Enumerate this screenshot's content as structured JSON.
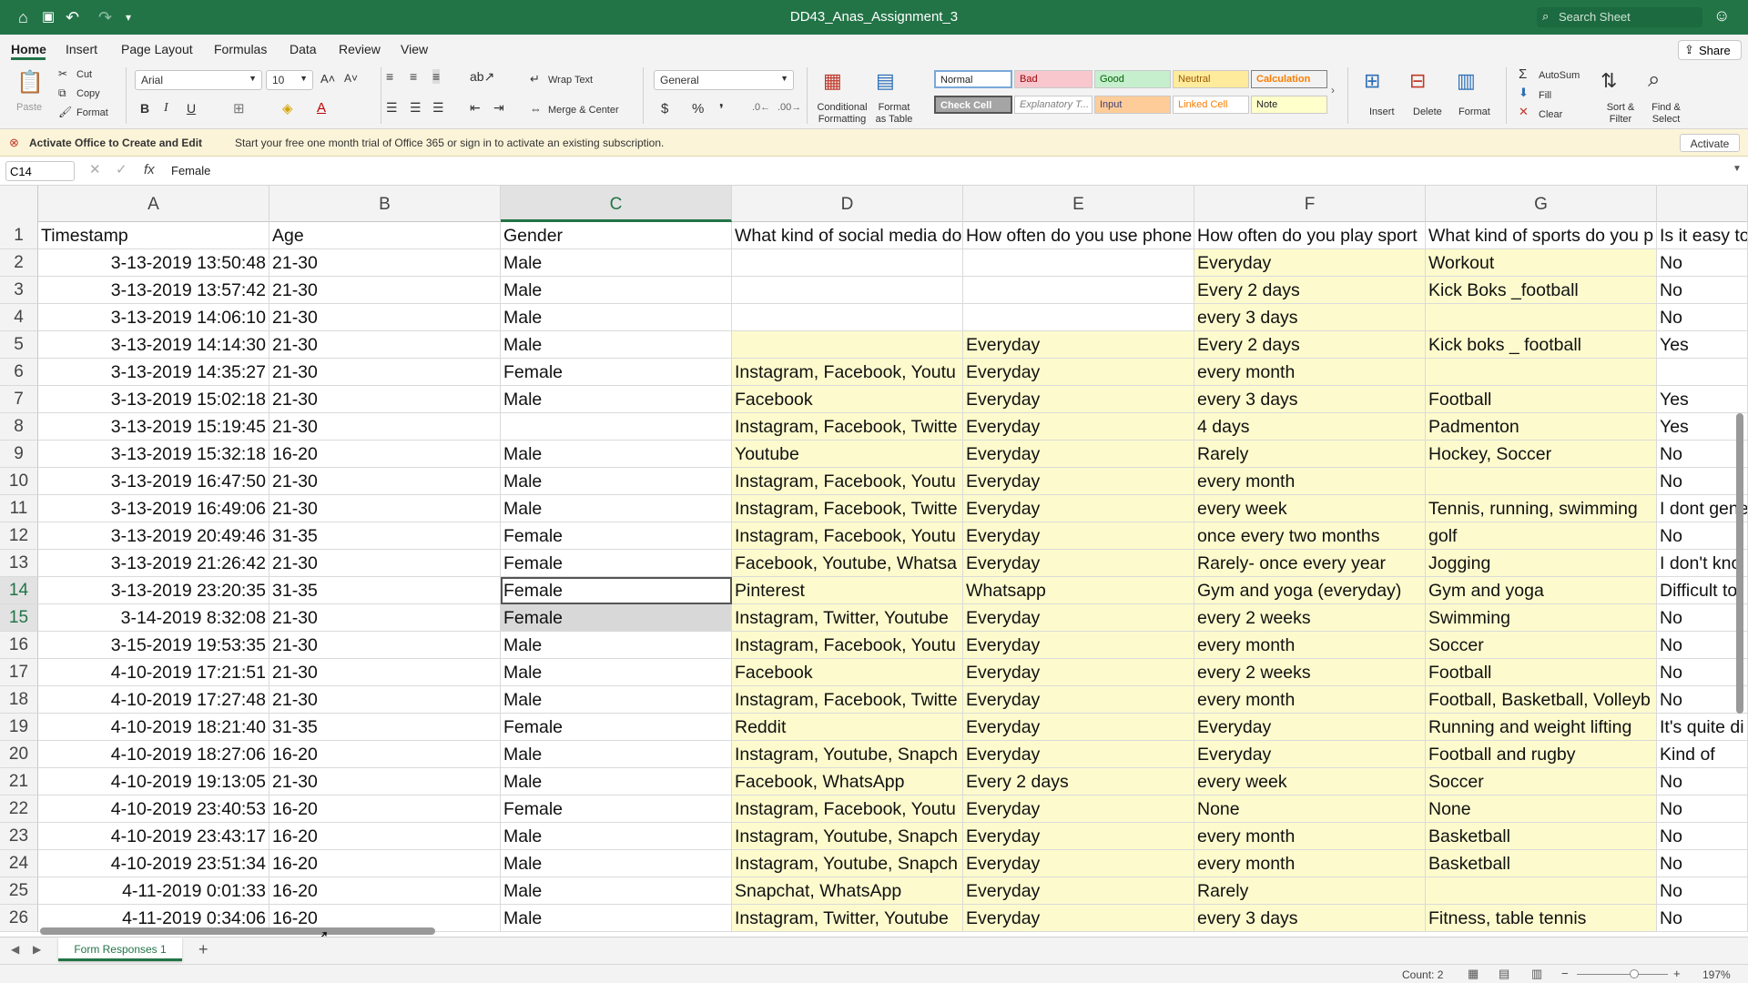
{
  "app": {
    "title": "DD43_Anas_Assignment_3",
    "search_placeholder": "Search Sheet",
    "quick_access": [
      "home-icon",
      "save-icon",
      "undo-icon",
      "redo-icon",
      "customize-icon"
    ]
  },
  "tabs": [
    "Home",
    "Insert",
    "Page Layout",
    "Formulas",
    "Data",
    "Review",
    "View"
  ],
  "share_label": "Share",
  "ribbon": {
    "paste": "Paste",
    "cut": "Cut",
    "copy": "Copy",
    "format": "Format",
    "font_name": "Arial",
    "font_size": "10",
    "wrap_text": "Wrap Text",
    "merge_center": "Merge & Center",
    "number_format": "General",
    "conditional_formatting": [
      "Conditional",
      "Formatting"
    ],
    "format_as_table": [
      "Format",
      "as Table"
    ],
    "styles": [
      {
        "label": "Normal",
        "bg": "#ffffff",
        "fg": "#222222"
      },
      {
        "label": "Bad",
        "bg": "#f8c7ce",
        "fg": "#9c0006"
      },
      {
        "label": "Good",
        "bg": "#c6efce",
        "fg": "#006100"
      },
      {
        "label": "Neutral",
        "bg": "#feeb9c",
        "fg": "#9c5700"
      },
      {
        "label": "Calculation",
        "bg": "#f2f2f2",
        "fg": "#fa7d00"
      },
      {
        "label": "Check Cell",
        "bg": "#a5a5a5",
        "fg": "#ffffff"
      },
      {
        "label": "Explanatory T...",
        "bg": "#ffffff",
        "fg": "#7f7f7f"
      },
      {
        "label": "Input",
        "bg": "#fecc99",
        "fg": "#3f3f76"
      },
      {
        "label": "Linked Cell",
        "bg": "#ffffff",
        "fg": "#fa7d00"
      },
      {
        "label": "Note",
        "bg": "#ffffcc",
        "fg": "#222222"
      }
    ],
    "insert": "Insert",
    "delete": "Delete",
    "format_cells": "Format",
    "autosum": "AutoSum",
    "fill": "Fill",
    "clear": "Clear",
    "sort_filter": [
      "Sort &",
      "Filter"
    ],
    "find_select": [
      "Find &",
      "Select"
    ]
  },
  "message": {
    "title": "Activate Office to Create and Edit",
    "text": "Start your free one month trial of Office 365 or sign in to activate an existing subscription.",
    "button": "Activate"
  },
  "formula_bar": {
    "cell_ref": "C14",
    "fx": "fx",
    "value": "Female"
  },
  "columns": [
    "A",
    "B",
    "C",
    "D",
    "E",
    "F",
    "G",
    ""
  ],
  "rows": [
    {
      "n": "1",
      "cells": [
        "Timestamp",
        "Age",
        "Gender",
        "What kind of social media do",
        "How often do you use phone",
        "How often do you play sport",
        "What kind of sports do you p",
        "Is it easy to"
      ]
    },
    {
      "n": "2",
      "cells": [
        "3-13-2019 13:50:48",
        "21-30",
        "Male",
        "",
        "",
        "Everyday",
        "Workout",
        "No"
      ]
    },
    {
      "n": "3",
      "cells": [
        "3-13-2019 13:57:42",
        "21-30",
        "Male",
        "",
        "",
        "Every 2 days",
        "Kick Boks _football",
        "No"
      ]
    },
    {
      "n": "4",
      "cells": [
        "3-13-2019 14:06:10",
        "21-30",
        "Male",
        "",
        "",
        "every 3 days",
        "",
        "No"
      ]
    },
    {
      "n": "5",
      "cells": [
        "3-13-2019 14:14:30",
        "21-30",
        "Male",
        "",
        "Everyday",
        "Every 2 days",
        "Kick boks _ football",
        "Yes"
      ]
    },
    {
      "n": "6",
      "cells": [
        "3-13-2019 14:35:27",
        "21-30",
        "Female",
        "Instagram, Facebook, Youtu",
        "Everyday",
        "every month",
        "",
        ""
      ]
    },
    {
      "n": "7",
      "cells": [
        "3-13-2019 15:02:18",
        "21-30",
        "Male",
        "Facebook",
        "Everyday",
        "every 3 days",
        "Football",
        "Yes"
      ]
    },
    {
      "n": "8",
      "cells": [
        "3-13-2019 15:19:45",
        "21-30",
        "",
        "Instagram, Facebook, Twitte",
        "Everyday",
        "4 days",
        "Padmenton",
        "Yes"
      ]
    },
    {
      "n": "9",
      "cells": [
        "3-13-2019 15:32:18",
        "16-20",
        "Male",
        "Youtube",
        "Everyday",
        "Rarely",
        "Hockey, Soccer",
        "No"
      ]
    },
    {
      "n": "10",
      "cells": [
        "3-13-2019 16:47:50",
        "21-30",
        "Male",
        "Instagram, Facebook, Youtu",
        "Everyday",
        "every month",
        "",
        "No"
      ]
    },
    {
      "n": "11",
      "cells": [
        "3-13-2019 16:49:06",
        "21-30",
        "Male",
        "Instagram, Facebook, Twitte",
        "Everyday",
        "every week",
        "Tennis, running, swimming",
        "I dont gene"
      ]
    },
    {
      "n": "12",
      "cells": [
        "3-13-2019 20:49:46",
        "31-35",
        "Female",
        "Instagram, Facebook, Youtu",
        "Everyday",
        "once every two months",
        "golf",
        "No"
      ]
    },
    {
      "n": "13",
      "cells": [
        "3-13-2019 21:26:42",
        "21-30",
        "Female",
        "Facebook, Youtube, Whatsa",
        "Everyday",
        "Rarely- once every year",
        "Jogging",
        "I don't kno"
      ]
    },
    {
      "n": "14",
      "cells": [
        "3-13-2019 23:20:35",
        "31-35",
        "Female",
        "Pinterest",
        "Whatsapp",
        "Gym and yoga (everyday)",
        "Gym and yoga",
        "Difficult to"
      ]
    },
    {
      "n": "15",
      "cells": [
        "3-14-2019 8:32:08",
        "21-30",
        "Female",
        "Instagram, Twitter, Youtube",
        "Everyday",
        "every 2 weeks",
        "Swimming",
        "No"
      ]
    },
    {
      "n": "16",
      "cells": [
        "3-15-2019 19:53:35",
        "21-30",
        "Male",
        "Instagram, Facebook, Youtu",
        "Everyday",
        "every month",
        "Soccer",
        "No"
      ]
    },
    {
      "n": "17",
      "cells": [
        "4-10-2019 17:21:51",
        "21-30",
        "Male",
        "Facebook",
        "Everyday",
        "every 2 weeks",
        "Football",
        "No"
      ]
    },
    {
      "n": "18",
      "cells": [
        "4-10-2019 17:27:48",
        "21-30",
        "Male",
        "Instagram, Facebook, Twitte",
        "Everyday",
        "every month",
        "Football, Basketball, Volleyb",
        "No"
      ]
    },
    {
      "n": "19",
      "cells": [
        "4-10-2019 18:21:40",
        "31-35",
        "Female",
        "Reddit",
        "Everyday",
        "Everyday",
        "Running and weight lifting",
        "It's quite di"
      ]
    },
    {
      "n": "20",
      "cells": [
        "4-10-2019 18:27:06",
        "16-20",
        "Male",
        "Instagram, Youtube, Snapch",
        "Everyday",
        "Everyday",
        " Football and rugby",
        "Kind of"
      ]
    },
    {
      "n": "21",
      "cells": [
        "4-10-2019 19:13:05",
        "21-30",
        "Male",
        "Facebook, WhatsApp",
        "Every 2 days",
        "every week",
        "Soccer",
        "No"
      ]
    },
    {
      "n": "22",
      "cells": [
        "4-10-2019 23:40:53",
        "16-20",
        "Female",
        "Instagram, Facebook, Youtu",
        "Everyday",
        "None",
        "None",
        "No"
      ]
    },
    {
      "n": "23",
      "cells": [
        "4-10-2019 23:43:17",
        "16-20",
        "Male",
        "Instagram, Youtube, Snapch",
        "Everyday",
        "every month",
        "Basketball",
        "No"
      ]
    },
    {
      "n": "24",
      "cells": [
        "4-10-2019 23:51:34",
        "16-20",
        "Male",
        "Instagram, Youtube, Snapch",
        "Everyday",
        "every month",
        "Basketball",
        "No"
      ]
    },
    {
      "n": "25",
      "cells": [
        "4-11-2019 0:01:33",
        "16-20",
        "Male",
        "Snapchat, WhatsApp",
        "Everyday",
        "Rarely",
        "",
        "No"
      ]
    },
    {
      "n": "26",
      "cells": [
        "4-11-2019 0:34:06",
        "16-20",
        "Male",
        "Instagram, Twitter, Youtube",
        "Everyday",
        "every 3 days",
        "Fitness, table tennis",
        "No"
      ]
    }
  ],
  "sheet_tab": "Form Responses 1",
  "status": {
    "count": "Count: 2",
    "zoom": "197%"
  }
}
